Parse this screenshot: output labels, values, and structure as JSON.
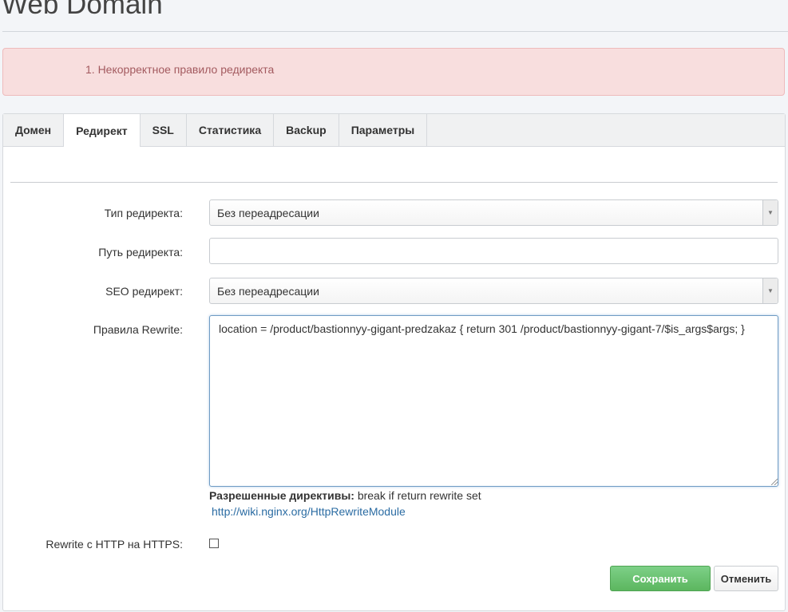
{
  "page": {
    "title": "Web Domain"
  },
  "alert": {
    "message": "1. Некорректное правило редиректа"
  },
  "tabs": [
    {
      "label": "Домен",
      "active": false
    },
    {
      "label": "Редирект",
      "active": true
    },
    {
      "label": "SSL",
      "active": false
    },
    {
      "label": "Статистика",
      "active": false
    },
    {
      "label": "Backup",
      "active": false
    },
    {
      "label": "Параметры",
      "active": false
    }
  ],
  "form": {
    "redirect_type": {
      "label": "Тип редиректа:",
      "value": "Без переадресации"
    },
    "redirect_path": {
      "label": "Путь редиректа:",
      "value": ""
    },
    "seo_redirect": {
      "label": "SEO редирект:",
      "value": "Без переадресации"
    },
    "rewrite_rules": {
      "label": "Правила Rewrite:",
      "value": "location = /product/bastionnyy-gigant-predzakaz { return 301 /product/bastionnyy-gigant-7/$is_args$args; }"
    },
    "help": {
      "strong": "Разрешенные директивы:",
      "text": " break if return rewrite set",
      "link": "http://wiki.nginx.org/HttpRewriteModule"
    },
    "https_rewrite": {
      "label": "Rewrite с HTTP на HTTPS:",
      "checked": false
    }
  },
  "buttons": {
    "save": "Сохранить",
    "cancel": "Отменить"
  },
  "colors": {
    "alert_bg": "#f8dede",
    "alert_text": "#a35a5f",
    "save_button": "#5cb65f",
    "link": "#2b6ca3"
  },
  "icons": {
    "select_arrow": "triangle-down-icon",
    "resize_grip": "resize-grip-icon"
  }
}
